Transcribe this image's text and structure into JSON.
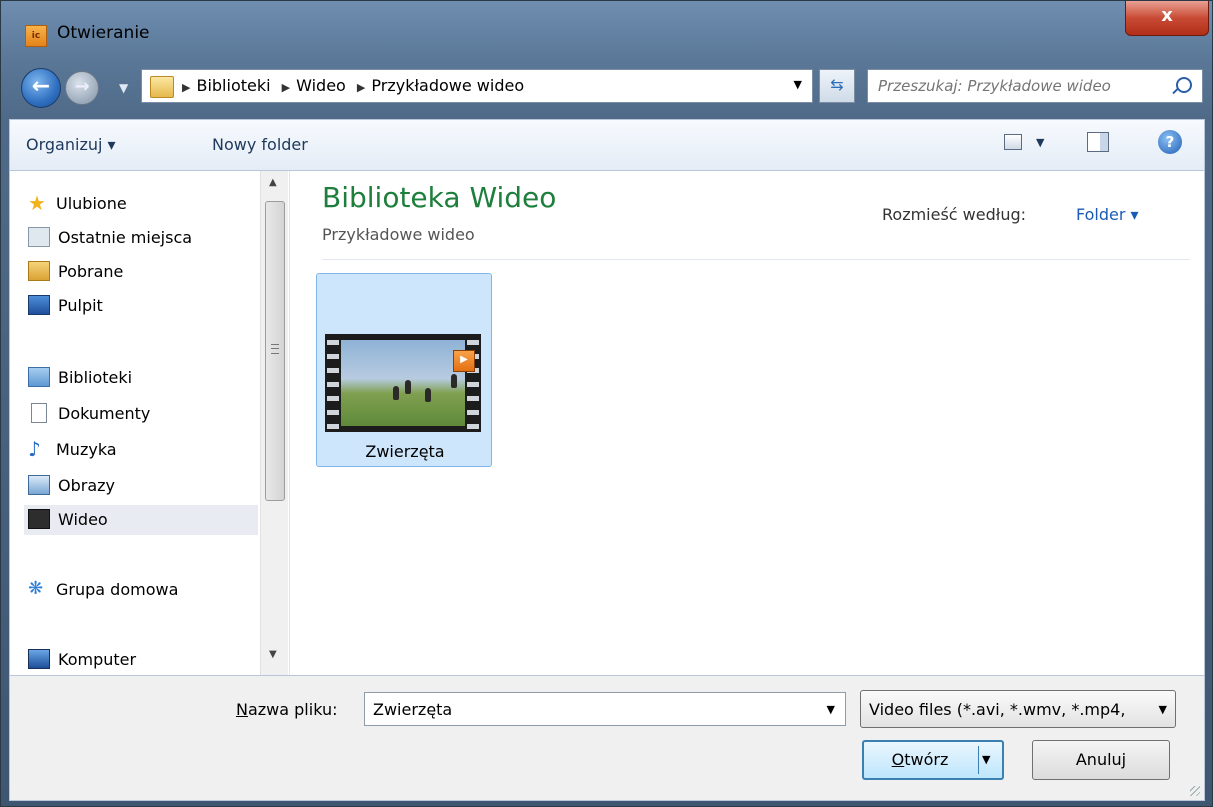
{
  "window": {
    "title": "Otwieranie",
    "app_icon_text": "ic",
    "close_label": "x"
  },
  "navigation": {
    "breadcrumbs": [
      "Biblioteki",
      "Wideo",
      "Przykładowe wideo"
    ],
    "search_placeholder": "Przeszukaj: Przykładowe wideo"
  },
  "toolbar": {
    "organize_label": "Organizuj ▾",
    "new_folder_label": "Nowy folder"
  },
  "sidebar": {
    "items": [
      {
        "label": "Ulubione",
        "icon": "star-icon"
      },
      {
        "label": "Ostatnie miejsca",
        "icon": "recent-places-icon"
      },
      {
        "label": "Pobrane",
        "icon": "downloads-folder-icon"
      },
      {
        "label": "Pulpit",
        "icon": "desktop-icon"
      },
      {
        "label": "Biblioteki",
        "icon": "libraries-icon"
      },
      {
        "label": "Dokumenty",
        "icon": "documents-icon"
      },
      {
        "label": "Muzyka",
        "icon": "music-note-icon"
      },
      {
        "label": "Obrazy",
        "icon": "pictures-icon"
      },
      {
        "label": "Wideo",
        "icon": "video-icon",
        "selected": true
      },
      {
        "label": "Grupa domowa",
        "icon": "homegroup-icon"
      },
      {
        "label": "Komputer",
        "icon": "computer-icon"
      }
    ]
  },
  "main": {
    "library_title": "Biblioteka Wideo",
    "library_subtitle": "Przykładowe wideo",
    "arrange_label": "Rozmieść według:",
    "arrange_value": "Folder ▾",
    "files": [
      {
        "name": "Zwierzęta",
        "type": "video-folder",
        "selected": true
      }
    ]
  },
  "footer": {
    "filename_label_prefix": "N",
    "filename_label_rest": "azwa pliku:",
    "filename_value": "Zwierzęta",
    "filetype_value": "Video files (*.avi, *.wmv, *.mp4,",
    "open_label_prefix": "O",
    "open_label_rest": "twórz",
    "cancel_label": "Anuluj"
  },
  "colors": {
    "accent": "#1a5cb5",
    "library_title": "#1e7f3d",
    "selection": "#cde6fb"
  }
}
